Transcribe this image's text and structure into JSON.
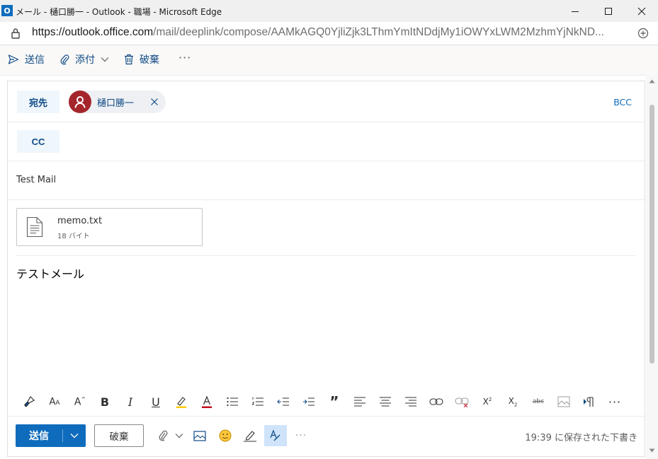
{
  "window": {
    "title": "メール - 樋口勝一 - Outlook - 職場 - Microsoft Edge",
    "app_icon_letter": "O"
  },
  "address": {
    "url_host": "https://outlook.office.com",
    "url_path": "/mail/deeplink/compose/AAMkAGQ0YjliZjk3LThmYmItNDdjMy1iOWYxLWM2MzhmYjNkND..."
  },
  "commands": {
    "send": "送信",
    "attach": "添付",
    "discard": "破棄",
    "more": "···"
  },
  "compose": {
    "to_label": "宛先",
    "cc_label": "CC",
    "bcc_label": "BCC",
    "recipient": "樋口勝一",
    "subject": "Test Mail",
    "attachment": {
      "name": "memo.txt",
      "size": "18 バイト"
    },
    "body": "テストメール"
  },
  "format_toolbar": [
    "brush-icon",
    "font-size-icon",
    "grow-font-icon",
    "bold-icon",
    "italic-icon",
    "underline-icon",
    "highlight-icon",
    "font-color-icon",
    "bullets-icon",
    "numbering-icon",
    "decrease-indent-icon",
    "increase-indent-icon",
    "quote-icon",
    "align-left-icon",
    "align-center-icon",
    "align-right-icon",
    "link-icon",
    "unlink-icon",
    "superscript-icon",
    "subscript-icon",
    "strikethrough-icon",
    "picture-inline-icon",
    "ltr-icon",
    "more-icon"
  ],
  "bottom": {
    "send": "送信",
    "discard": "破棄",
    "more": "···",
    "saved_status": "19:39 に保存された下書き"
  },
  "colors": {
    "accent": "#0f6cbd",
    "avatar": "#a4262c",
    "link_text": "#0f4a85"
  }
}
